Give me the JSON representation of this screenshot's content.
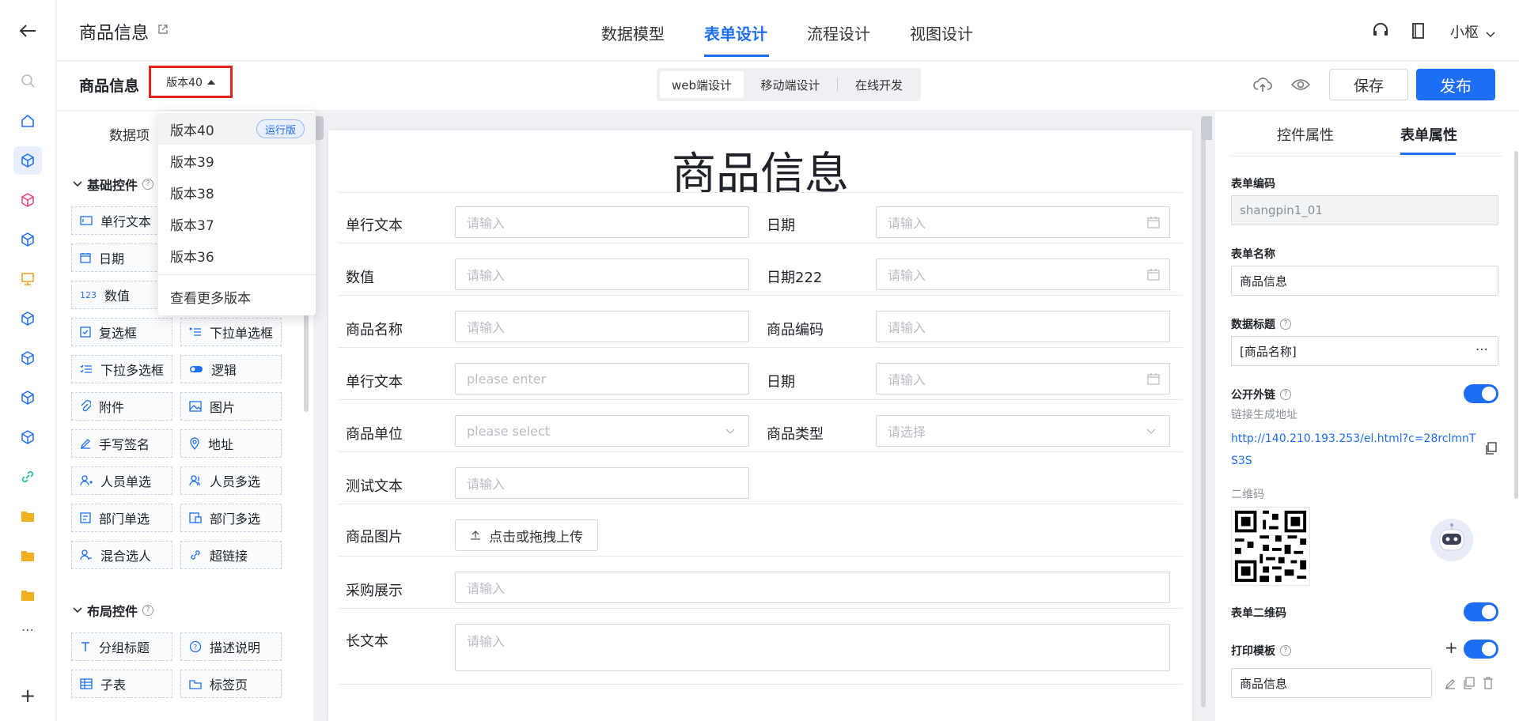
{
  "header": {
    "app_title": "商品信息",
    "tabs": [
      {
        "label": "数据模型"
      },
      {
        "label": "表单设计"
      },
      {
        "label": "流程设计"
      },
      {
        "label": "视图设计"
      }
    ],
    "active_tab": "表单设计",
    "user_name": "小枢"
  },
  "toolbar": {
    "form_name": "商品信息",
    "version_label": "版本40",
    "mode_tabs": [
      {
        "label": "web端设计"
      },
      {
        "label": "移动端设计"
      },
      {
        "label": "在线开发"
      }
    ],
    "active_mode": "web端设计",
    "save_label": "保存",
    "publish_label": "发布"
  },
  "version_dropdown": {
    "items": [
      {
        "label": "版本40",
        "badge": "运行版"
      },
      {
        "label": "版本39"
      },
      {
        "label": "版本38"
      },
      {
        "label": "版本37"
      },
      {
        "label": "版本36"
      }
    ],
    "more_label": "查看更多版本"
  },
  "left_panel": {
    "tab_label": "数据项",
    "basic_section": "基础控件",
    "basic_items": [
      {
        "label": "单行文本",
        "icon": "text-field-icon"
      },
      {
        "label": "日期",
        "icon": "calendar-icon"
      },
      {
        "label": "数值",
        "icon": "number-icon"
      },
      {
        "label": "复选框",
        "icon": "checkbox-icon"
      },
      {
        "label": "下拉单选框",
        "icon": "dropdown-single-icon"
      },
      {
        "label": "下拉多选框",
        "icon": "dropdown-multi-icon"
      },
      {
        "label": "逻辑",
        "icon": "toggle-icon"
      },
      {
        "label": "附件",
        "icon": "attachment-icon"
      },
      {
        "label": "图片",
        "icon": "image-icon"
      },
      {
        "label": "手写签名",
        "icon": "pen-icon"
      },
      {
        "label": "地址",
        "icon": "location-icon"
      },
      {
        "label": "人员单选",
        "icon": "user-icon"
      },
      {
        "label": "人员多选",
        "icon": "users-icon"
      },
      {
        "label": "部门单选",
        "icon": "department-icon"
      },
      {
        "label": "部门多选",
        "icon": "departments-icon"
      },
      {
        "label": "混合选人",
        "icon": "mixed-user-icon"
      },
      {
        "label": "超链接",
        "icon": "link-icon"
      }
    ],
    "layout_section": "布局控件",
    "layout_items": [
      {
        "label": "分组标题",
        "icon": "heading-icon"
      },
      {
        "label": "描述说明",
        "icon": "help-icon"
      },
      {
        "label": "子表",
        "icon": "table-icon"
      },
      {
        "label": "标签页",
        "icon": "tabs-icon"
      }
    ]
  },
  "canvas": {
    "title": "商品信息",
    "fields": [
      {
        "label": "单行文本",
        "placeholder": "请输入",
        "kind": "text"
      },
      {
        "label": "日期",
        "placeholder": "请输入",
        "kind": "date"
      },
      {
        "label": "数值",
        "placeholder": "请输入",
        "kind": "text"
      },
      {
        "label": "日期222",
        "placeholder": "请输入",
        "kind": "date"
      },
      {
        "label": "商品名称",
        "placeholder": "请输入",
        "kind": "text"
      },
      {
        "label": "商品编码",
        "placeholder": "请输入",
        "kind": "text"
      },
      {
        "label": "单行文本",
        "placeholder": "please enter",
        "kind": "text"
      },
      {
        "label": "日期",
        "placeholder": "请输入",
        "kind": "date"
      },
      {
        "label": "商品单位",
        "placeholder": "please select",
        "kind": "select"
      },
      {
        "label": "商品类型",
        "placeholder": "请选择",
        "kind": "select"
      },
      {
        "label": "测试文本",
        "placeholder": "请输入",
        "kind": "text"
      },
      {
        "label": "商品图片",
        "upload_label": "点击或拖拽上传",
        "kind": "upload"
      },
      {
        "label": "采购展示",
        "placeholder": "请输入",
        "kind": "text"
      },
      {
        "label": "长文本",
        "placeholder": "请输入",
        "kind": "textarea"
      }
    ]
  },
  "right_panel": {
    "tabs": [
      {
        "label": "控件属性"
      },
      {
        "label": "表单属性"
      }
    ],
    "active_tab": "表单属性",
    "form_code_label": "表单编码",
    "form_code_value": "shangpin1_01",
    "form_name_label": "表单名称",
    "form_name_value": "商品信息",
    "data_title_label": "数据标题",
    "data_title_value": "[商品名称]",
    "public_link_label": "公开外链",
    "public_link_on": true,
    "link_hint": "链接生成地址",
    "link_url": "http://140.210.193.253/el.html?c=28rclmnTS3S",
    "qr_label": "二维码",
    "form_qr_label": "表单二维码",
    "form_qr_on": true,
    "print_label": "打印模板",
    "print_on": true,
    "print_value": "商品信息"
  },
  "colors": {
    "accent": "#1e6ef4",
    "highlight_border": "#e2231a"
  }
}
